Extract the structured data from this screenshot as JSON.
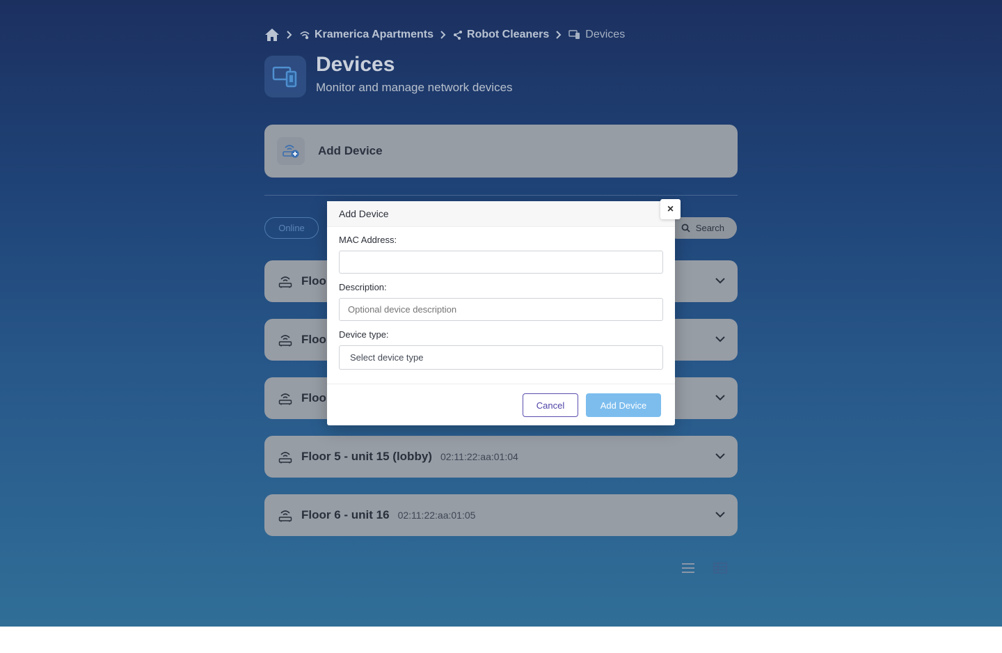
{
  "breadcrumb": {
    "items": [
      "Kramerica Apartments",
      "Robot Cleaners"
    ],
    "current": "Devices"
  },
  "header": {
    "title": "Devices",
    "subtitle": "Monitor and manage network devices"
  },
  "add_card": {
    "label": "Add Device"
  },
  "filters": {
    "online_label": "Online",
    "search_label": "Search"
  },
  "devices": [
    {
      "name": "Floor",
      "mac": ""
    },
    {
      "name": "Floor",
      "mac": ""
    },
    {
      "name": "Floor",
      "mac": ""
    },
    {
      "name": "Floor 5 - unit 15 (lobby)",
      "mac": "02:11:22:aa:01:04"
    },
    {
      "name": "Floor 6 - unit 16",
      "mac": "02:11:22:aa:01:05"
    }
  ],
  "modal": {
    "title": "Add Device",
    "close": "×",
    "mac_label": "MAC Address:",
    "mac_value": "",
    "description_label": "Description:",
    "description_placeholder": "Optional device description",
    "type_label": "Device type:",
    "type_selected": "Select device type",
    "cancel_label": "Cancel",
    "submit_label": "Add Device"
  },
  "colors": {
    "accent": "#7cbdee",
    "cancel_border": "#5a4eb0",
    "card_bg": "#979da5"
  }
}
